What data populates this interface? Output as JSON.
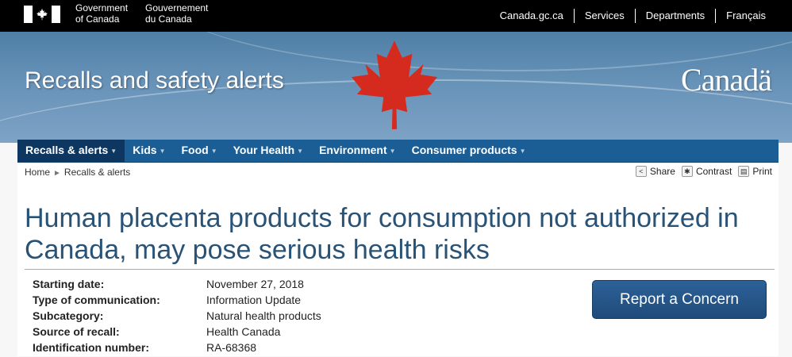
{
  "fip": {
    "signature_en_1": "Government",
    "signature_en_2": "of Canada",
    "signature_fr_1": "Gouvernement",
    "signature_fr_2": "du Canada",
    "links": [
      "Canada.gc.ca",
      "Services",
      "Departments",
      "Français"
    ]
  },
  "banner": {
    "title": "Recalls and safety alerts",
    "wordmark": "Canadä"
  },
  "nav": {
    "items": [
      "Recalls & alerts",
      "Kids",
      "Food",
      "Your Health",
      "Environment",
      "Consumer products"
    ]
  },
  "breadcrumb": [
    "Home",
    "Recalls & alerts"
  ],
  "tools": {
    "share": "Share",
    "contrast": "Contrast",
    "print": "Print"
  },
  "page_title": "Human placenta products for consumption not authorized in Canada, may pose serious health risks",
  "meta": [
    {
      "label": "Starting date:",
      "value": "November 27, 2018"
    },
    {
      "label": "Type of communication:",
      "value": "Information Update"
    },
    {
      "label": "Subcategory:",
      "value": "Natural health products"
    },
    {
      "label": "Source of recall:",
      "value": "Health Canada"
    },
    {
      "label": "Identification number:",
      "value": "RA-68368"
    }
  ],
  "report_button": "Report a Concern",
  "colors": {
    "nav": "#1b5e96",
    "title": "#295376",
    "leaf": "#d52b1e"
  }
}
